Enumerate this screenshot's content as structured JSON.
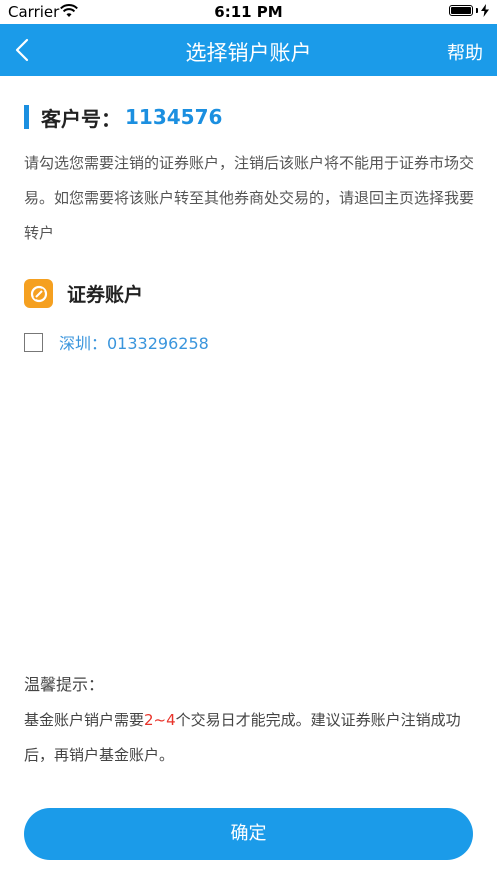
{
  "status_bar": {
    "carrier": "Carrier",
    "time": "6:11 PM"
  },
  "nav": {
    "title": "选择销户账户",
    "help_label": "帮助",
    "back_icon": "chevron-left-icon"
  },
  "customer": {
    "label": "客户号：",
    "number": "1134576"
  },
  "description": "请勾选您需要注销的证券账户，注销后该账户将不能用于证券市场交易。如您需要将该账户转至其他券商处交易的，请退回主页选择我要转户",
  "securities": {
    "title": "证券账户",
    "icon": "securities-account-icon",
    "accounts": [
      {
        "label": "深圳：0133296258",
        "checked": false
      }
    ]
  },
  "tips": {
    "title": "温馨提示：",
    "body_before": "基金账户销户需要",
    "body_highlight": "2~4",
    "body_after": "个交易日才能完成。建议证券账户注销成功后，再销户基金账户。"
  },
  "confirm_label": "确定",
  "colors": {
    "primary": "#1b9be9",
    "accent_blue": "#1b8fe0",
    "highlight_red": "#e8332a",
    "icon_orange": "#f5a020"
  }
}
